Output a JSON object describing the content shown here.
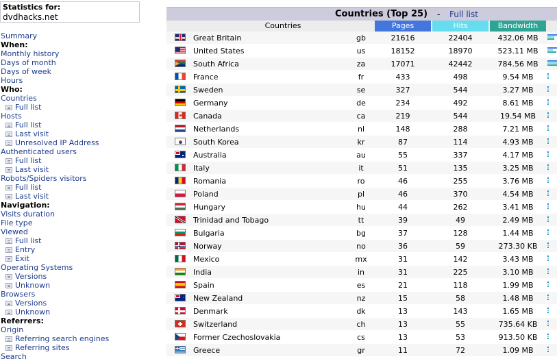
{
  "stats": {
    "label": "Statistics for:",
    "site": "dvdhacks.net"
  },
  "menu": [
    {
      "text": "Summary",
      "kind": "link"
    },
    {
      "text": "When:",
      "kind": "header"
    },
    {
      "text": "Monthly history",
      "kind": "link"
    },
    {
      "text": "Days of month",
      "kind": "link"
    },
    {
      "text": "Days of week",
      "kind": "link"
    },
    {
      "text": "Hours",
      "kind": "link"
    },
    {
      "text": "Who:",
      "kind": "header"
    },
    {
      "text": "Countries",
      "kind": "link"
    },
    {
      "text": "Full list",
      "kind": "sub"
    },
    {
      "text": "Hosts",
      "kind": "link"
    },
    {
      "text": "Full list",
      "kind": "sub"
    },
    {
      "text": "Last visit",
      "kind": "sub"
    },
    {
      "text": "Unresolved IP Address",
      "kind": "sub"
    },
    {
      "text": "Authenticated users",
      "kind": "link"
    },
    {
      "text": "Full list",
      "kind": "sub"
    },
    {
      "text": "Last visit",
      "kind": "sub"
    },
    {
      "text": "Robots/Spiders visitors",
      "kind": "link"
    },
    {
      "text": "Full list",
      "kind": "sub"
    },
    {
      "text": "Last visit",
      "kind": "sub"
    },
    {
      "text": "Navigation:",
      "kind": "header"
    },
    {
      "text": "Visits duration",
      "kind": "link"
    },
    {
      "text": "File type",
      "kind": "link"
    },
    {
      "text": "Viewed",
      "kind": "link"
    },
    {
      "text": "Full list",
      "kind": "sub"
    },
    {
      "text": "Entry",
      "kind": "sub"
    },
    {
      "text": "Exit",
      "kind": "sub"
    },
    {
      "text": "Operating Systems",
      "kind": "link"
    },
    {
      "text": "Versions",
      "kind": "sub"
    },
    {
      "text": "Unknown",
      "kind": "sub"
    },
    {
      "text": "Browsers",
      "kind": "link"
    },
    {
      "text": "Versions",
      "kind": "sub"
    },
    {
      "text": "Unknown",
      "kind": "sub"
    },
    {
      "text": "Referrers:",
      "kind": "header"
    },
    {
      "text": "Origin",
      "kind": "link"
    },
    {
      "text": "Referring search engines",
      "kind": "sub"
    },
    {
      "text": "Referring sites",
      "kind": "sub"
    },
    {
      "text": "Search",
      "kind": "link"
    }
  ],
  "panel": {
    "title": "Countries (Top 25)",
    "separator": "-",
    "full_list": "Full list",
    "columns": {
      "countries": "Countries",
      "pages": "Pages",
      "hits": "Hits",
      "bandwidth": "Bandwidth"
    }
  },
  "colors": {
    "pages": "#4477dd",
    "hits": "#66ddee",
    "bandwidth": "#2ea495",
    "title_bg": "#ccccdd",
    "link": "#1e3c8c"
  },
  "rows": [
    {
      "country": "Great Britain",
      "code": "gb",
      "pages": 21616,
      "hits": 22404,
      "bandwidth": "432.06 MB",
      "flag": "gb-flag-icon"
    },
    {
      "country": "United States",
      "code": "us",
      "pages": 18152,
      "hits": 18970,
      "bandwidth": "523.11 MB",
      "flag": "us-flag-icon"
    },
    {
      "country": "South Africa",
      "code": "za",
      "pages": 17071,
      "hits": 42442,
      "bandwidth": "784.56 MB",
      "flag": "za-flag-icon"
    },
    {
      "country": "France",
      "code": "fr",
      "pages": 433,
      "hits": 498,
      "bandwidth": "9.54 MB",
      "flag": "fr-flag-icon"
    },
    {
      "country": "Sweden",
      "code": "se",
      "pages": 327,
      "hits": 544,
      "bandwidth": "3.27 MB",
      "flag": "se-flag-icon"
    },
    {
      "country": "Germany",
      "code": "de",
      "pages": 234,
      "hits": 492,
      "bandwidth": "8.61 MB",
      "flag": "de-flag-icon"
    },
    {
      "country": "Canada",
      "code": "ca",
      "pages": 219,
      "hits": 544,
      "bandwidth": "19.54 MB",
      "flag": "ca-flag-icon"
    },
    {
      "country": "Netherlands",
      "code": "nl",
      "pages": 148,
      "hits": 288,
      "bandwidth": "7.21 MB",
      "flag": "nl-flag-icon"
    },
    {
      "country": "South Korea",
      "code": "kr",
      "pages": 87,
      "hits": 114,
      "bandwidth": "4.93 MB",
      "flag": "kr-flag-icon"
    },
    {
      "country": "Australia",
      "code": "au",
      "pages": 55,
      "hits": 337,
      "bandwidth": "4.17 MB",
      "flag": "au-flag-icon"
    },
    {
      "country": "Italy",
      "code": "it",
      "pages": 51,
      "hits": 135,
      "bandwidth": "3.25 MB",
      "flag": "it-flag-icon"
    },
    {
      "country": "Romania",
      "code": "ro",
      "pages": 46,
      "hits": 255,
      "bandwidth": "3.76 MB",
      "flag": "ro-flag-icon"
    },
    {
      "country": "Poland",
      "code": "pl",
      "pages": 46,
      "hits": 370,
      "bandwidth": "4.54 MB",
      "flag": "pl-flag-icon"
    },
    {
      "country": "Hungary",
      "code": "hu",
      "pages": 44,
      "hits": 262,
      "bandwidth": "3.41 MB",
      "flag": "hu-flag-icon"
    },
    {
      "country": "Trinidad and Tobago",
      "code": "tt",
      "pages": 39,
      "hits": 49,
      "bandwidth": "2.49 MB",
      "flag": "tt-flag-icon"
    },
    {
      "country": "Bulgaria",
      "code": "bg",
      "pages": 37,
      "hits": 128,
      "bandwidth": "1.44 MB",
      "flag": "bg-flag-icon"
    },
    {
      "country": "Norway",
      "code": "no",
      "pages": 36,
      "hits": 59,
      "bandwidth": "273.30 KB",
      "flag": "no-flag-icon"
    },
    {
      "country": "Mexico",
      "code": "mx",
      "pages": 31,
      "hits": 142,
      "bandwidth": "3.43 MB",
      "flag": "mx-flag-icon"
    },
    {
      "country": "India",
      "code": "in",
      "pages": 31,
      "hits": 225,
      "bandwidth": "3.10 MB",
      "flag": "in-flag-icon"
    },
    {
      "country": "Spain",
      "code": "es",
      "pages": 21,
      "hits": 118,
      "bandwidth": "1.99 MB",
      "flag": "es-flag-icon"
    },
    {
      "country": "New Zealand",
      "code": "nz",
      "pages": 15,
      "hits": 58,
      "bandwidth": "1.48 MB",
      "flag": "nz-flag-icon"
    },
    {
      "country": "Denmark",
      "code": "dk",
      "pages": 13,
      "hits": 143,
      "bandwidth": "1.65 MB",
      "flag": "dk-flag-icon"
    },
    {
      "country": "Switzerland",
      "code": "ch",
      "pages": 13,
      "hits": 55,
      "bandwidth": "735.64 KB",
      "flag": "ch-flag-icon"
    },
    {
      "country": "Former Czechoslovakia",
      "code": "cs",
      "pages": 13,
      "hits": 53,
      "bandwidth": "913.50 KB",
      "flag": "cs-flag-icon"
    },
    {
      "country": "Greece",
      "code": "gr",
      "pages": 11,
      "hits": 72,
      "bandwidth": "1.09 MB",
      "flag": "gr-flag-icon"
    }
  ]
}
